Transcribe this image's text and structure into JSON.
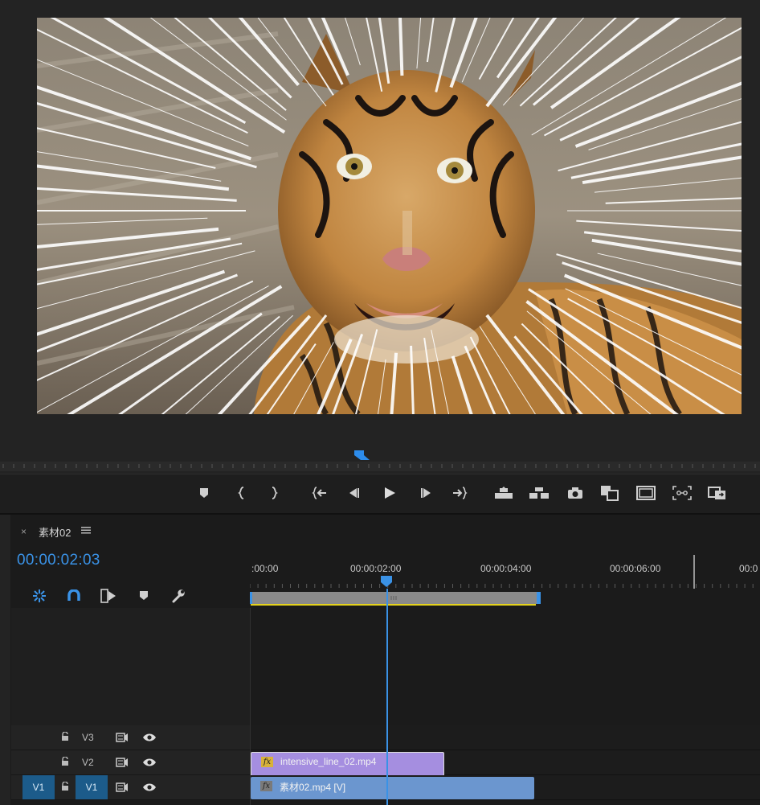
{
  "monitor": {
    "playhead_color": "#2d8ceb"
  },
  "transport": {
    "buttons": [
      {
        "name": "add-marker-icon"
      },
      {
        "name": "mark-in-icon"
      },
      {
        "name": "mark-out-icon"
      },
      {
        "name": "go-to-in-icon"
      },
      {
        "name": "step-back-icon"
      },
      {
        "name": "play-icon"
      },
      {
        "name": "step-forward-icon"
      },
      {
        "name": "go-to-out-icon"
      },
      {
        "name": "lift-icon"
      },
      {
        "name": "extract-icon"
      },
      {
        "name": "export-frame-icon"
      },
      {
        "name": "comparison-view-icon"
      },
      {
        "name": "safe-margins-icon"
      },
      {
        "name": "proxy-toggle-icon"
      },
      {
        "name": "vr-video-icon"
      }
    ]
  },
  "timeline": {
    "close_label": "×",
    "sequence_name": "素材02",
    "timecode": "00:00:02:03",
    "ruler_labels": [
      ":00:00",
      "00:00:02:00",
      "00:00:04:00",
      "00:00:06:00",
      "00:0"
    ],
    "tools": [
      "snap-icon",
      "magnet-icon",
      "linked-selection-icon",
      "add-marker-icon",
      "wrench-icon"
    ],
    "tracks": [
      {
        "id": "V3",
        "label": "V3",
        "clip": null
      },
      {
        "id": "V2",
        "label": "V2",
        "clip": {
          "name": "intensive_line_02.mp4",
          "fx": "fx",
          "color": "#a58ee0"
        }
      },
      {
        "id": "V1",
        "label": "V1",
        "source_patch": "V1",
        "clip": {
          "name": "素材02.mp4 [V]",
          "fx": "fx",
          "color": "#6b96cf"
        }
      }
    ],
    "accent": "#3a92e6"
  }
}
